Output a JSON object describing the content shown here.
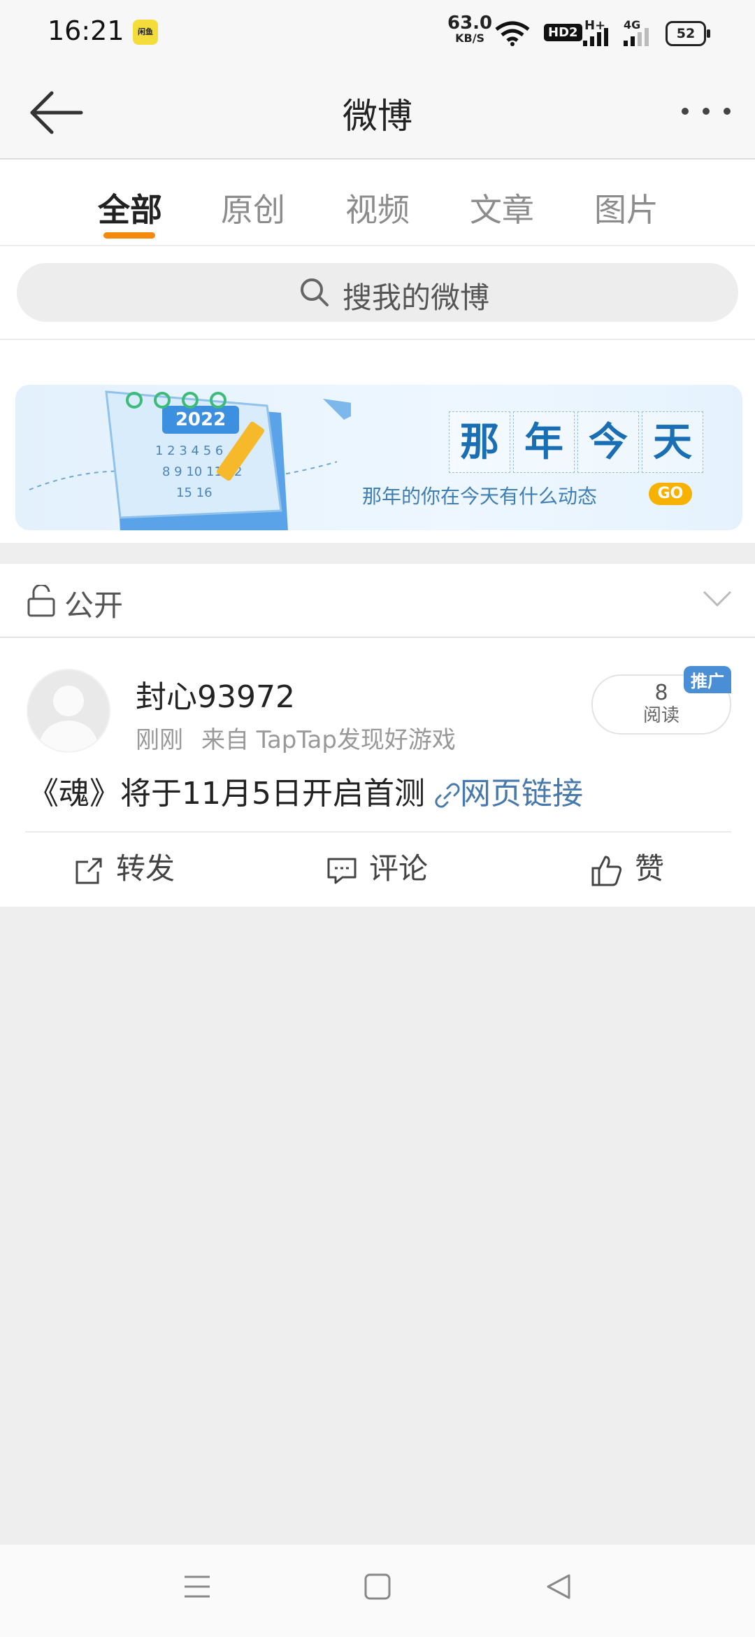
{
  "status_bar": {
    "time": "16:21",
    "badge_text": "闲鱼",
    "net_speed_value": "63.0",
    "net_speed_unit": "KB/S",
    "hd_label": "HD2",
    "h_label": "H+",
    "g_label": "4G",
    "battery": "52"
  },
  "nav": {
    "title": "微博"
  },
  "tabs": [
    {
      "label": "全部",
      "active": true
    },
    {
      "label": "原创",
      "active": false
    },
    {
      "label": "视频",
      "active": false
    },
    {
      "label": "文章",
      "active": false
    },
    {
      "label": "图片",
      "active": false
    }
  ],
  "search": {
    "placeholder": "搜我的微博"
  },
  "banner": {
    "title_chars": [
      "那",
      "年",
      "今",
      "天"
    ],
    "subtitle": "那年的你在今天有什么动态",
    "go_label": "GO",
    "calendar_year": "2022"
  },
  "visibility": {
    "label": "公开"
  },
  "post": {
    "username": "封心93972",
    "time": "刚刚",
    "source": "来自 TapTap发现好游戏",
    "read_count": "8",
    "read_label": "阅读",
    "promo_tag": "推广",
    "text": "《魂》将于11月5日开启首测",
    "link_text": "网页链接",
    "actions": {
      "repost": "转发",
      "comment": "评论",
      "like": "赞"
    }
  },
  "colors": {
    "accent": "#f5890c",
    "link": "#4879ad",
    "promo": "#4a8fd6"
  }
}
